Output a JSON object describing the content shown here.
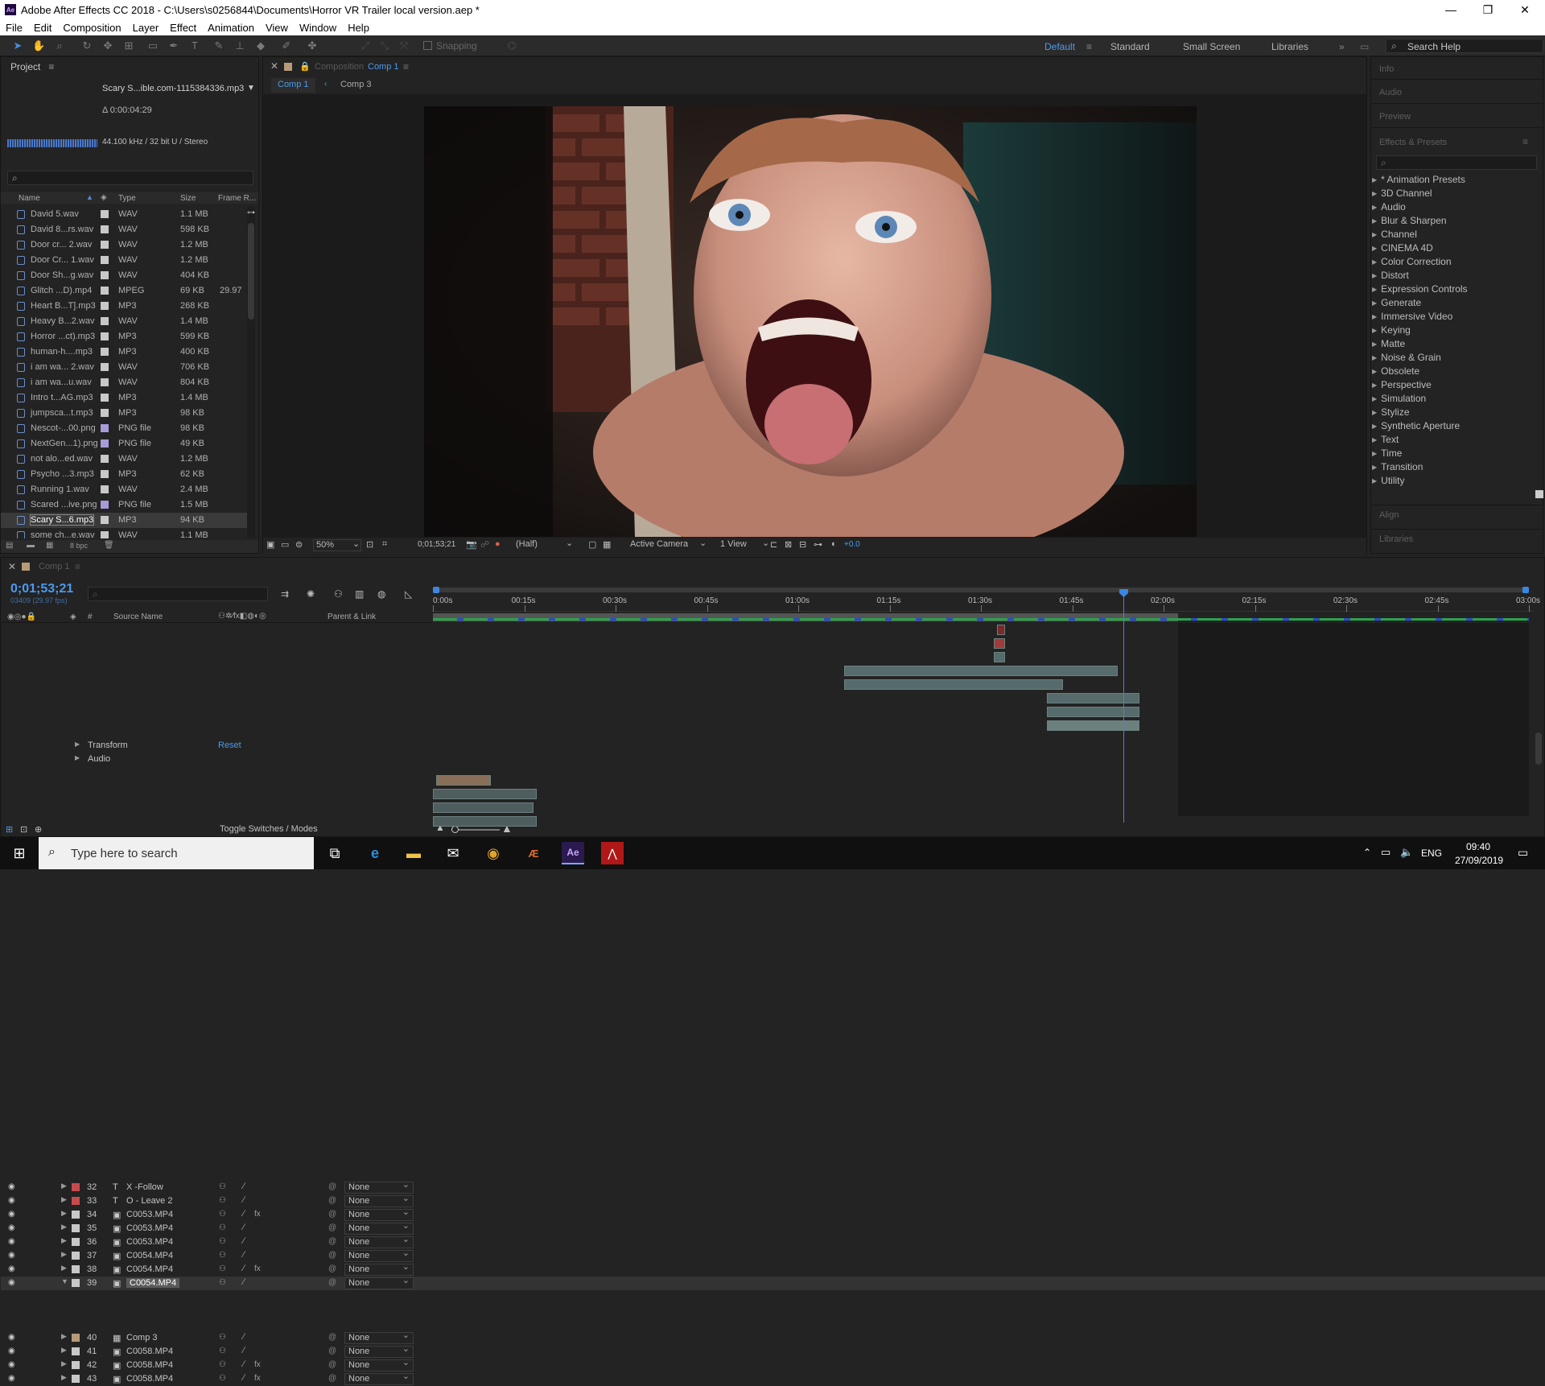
{
  "window": {
    "title": "Adobe After Effects CC 2018 - C:\\Users\\s0256844\\Documents\\Horror VR Trailer local version.aep *",
    "app_badge": "Ae"
  },
  "menu": [
    "File",
    "Edit",
    "Composition",
    "Layer",
    "Effect",
    "Animation",
    "View",
    "Window",
    "Help"
  ],
  "toolbar": {
    "snapping_label": "Snapping",
    "workspaces": [
      "Default",
      "Standard",
      "Small Screen",
      "Libraries"
    ],
    "active_workspace": "Default",
    "search_help": "Search Help"
  },
  "project": {
    "title": "Project",
    "selected_name": "Scary S...ible.com-1115384336.mp3",
    "duration": "Δ 0:00:04:29",
    "audio_info": "44.100 kHz / 32 bit U / Stereo",
    "search_icon": "search-icon",
    "columns": [
      "Name",
      "Type",
      "Size",
      "Frame R..."
    ],
    "items": [
      {
        "name": "David 5.wav",
        "type": "WAV",
        "size": "1.1 MB",
        "rate": "",
        "label_color": "#c8c8c8"
      },
      {
        "name": "David 8...rs.wav",
        "type": "WAV",
        "size": "598 KB",
        "rate": "",
        "label_color": "#c8c8c8"
      },
      {
        "name": "Door cr... 2.wav",
        "type": "WAV",
        "size": "1.2 MB",
        "rate": "",
        "label_color": "#c8c8c8"
      },
      {
        "name": "Door Cr... 1.wav",
        "type": "WAV",
        "size": "1.2 MB",
        "rate": "",
        "label_color": "#c8c8c8"
      },
      {
        "name": "Door Sh...g.wav",
        "type": "WAV",
        "size": "404 KB",
        "rate": "",
        "label_color": "#c8c8c8"
      },
      {
        "name": "Glitch ...D).mp4",
        "type": "MPEG",
        "size": "69 KB",
        "rate": "29.97",
        "label_color": "#c8c8c8"
      },
      {
        "name": "Heart B...T].mp3",
        "type": "MP3",
        "size": "268 KB",
        "rate": "",
        "label_color": "#c8c8c8"
      },
      {
        "name": "Heavy B...2.wav",
        "type": "WAV",
        "size": "1.4 MB",
        "rate": "",
        "label_color": "#c8c8c8"
      },
      {
        "name": "Horror ...ct).mp3",
        "type": "MP3",
        "size": "599 KB",
        "rate": "",
        "label_color": "#c8c8c8"
      },
      {
        "name": "human-h....mp3",
        "type": "MP3",
        "size": "400 KB",
        "rate": "",
        "label_color": "#c8c8c8"
      },
      {
        "name": "i am wa... 2.wav",
        "type": "WAV",
        "size": "706 KB",
        "rate": "",
        "label_color": "#c8c8c8"
      },
      {
        "name": "i am wa...u.wav",
        "type": "WAV",
        "size": "804 KB",
        "rate": "",
        "label_color": "#c8c8c8"
      },
      {
        "name": "Intro t...AG.mp3",
        "type": "MP3",
        "size": "1.4 MB",
        "rate": "",
        "label_color": "#c8c8c8"
      },
      {
        "name": "jumpsca...t.mp3",
        "type": "MP3",
        "size": "98 KB",
        "rate": "",
        "label_color": "#c8c8c8"
      },
      {
        "name": "Nescot-...00.png",
        "type": "PNG file",
        "size": "98 KB",
        "rate": "",
        "label_color": "#a99ad8"
      },
      {
        "name": "NextGen...1).png",
        "type": "PNG file",
        "size": "49 KB",
        "rate": "",
        "label_color": "#a99ad8"
      },
      {
        "name": "not alo...ed.wav",
        "type": "WAV",
        "size": "1.2 MB",
        "rate": "",
        "label_color": "#c8c8c8"
      },
      {
        "name": "Psycho ...3.mp3",
        "type": "MP3",
        "size": "62 KB",
        "rate": "",
        "label_color": "#c8c8c8"
      },
      {
        "name": "Running 1.wav",
        "type": "WAV",
        "size": "2.4 MB",
        "rate": "",
        "label_color": "#c8c8c8"
      },
      {
        "name": "Scared ...ive.png",
        "type": "PNG file",
        "size": "1.5 MB",
        "rate": "",
        "label_color": "#a99ad8"
      },
      {
        "name": "Scary S...6.mp3",
        "type": "MP3",
        "size": "94 KB",
        "rate": "",
        "label_color": "#c8c8c8",
        "selected": true
      },
      {
        "name": "some ch...e.wav",
        "type": "WAV",
        "size": "1.1 MB",
        "rate": "",
        "label_color": "#c8c8c8"
      }
    ],
    "bpc": "8 bpc"
  },
  "composition": {
    "panel_label": "Composition",
    "comp_name": "Comp 1",
    "tabs": [
      "Comp 1",
      "Comp 3"
    ],
    "zoom": "50%",
    "timecode": "0;01;53;21",
    "resolution": "(Half)",
    "camera": "Active Camera",
    "views": "1 View",
    "exposure": "+0.0"
  },
  "effects": {
    "panels_top": [
      "Info",
      "Audio",
      "Preview",
      "Effects & Presets"
    ],
    "categories": [
      "* Animation Presets",
      "3D Channel",
      "Audio",
      "Blur & Sharpen",
      "Channel",
      "CINEMA 4D",
      "Color Correction",
      "Distort",
      "Expression Controls",
      "Generate",
      "Immersive Video",
      "Keying",
      "Matte",
      "Noise & Grain",
      "Obsolete",
      "Perspective",
      "Simulation",
      "Stylize",
      "Synthetic Aperture",
      "Text",
      "Time",
      "Transition",
      "Utility"
    ],
    "panels_bottom": [
      "Align",
      "Libraries"
    ]
  },
  "timeline": {
    "tab": "Comp 1",
    "timecode": "0;01;53;21",
    "frames": "03409 (29.97 fps)",
    "col_source": "Source Name",
    "col_parent": "Parent & Link",
    "ruler": [
      "0:00s",
      "00:15s",
      "00:30s",
      "00:45s",
      "01:00s",
      "01:15s",
      "01:30s",
      "01:45s",
      "02:00s",
      "02:15s",
      "02:30s",
      "02:45s",
      "03:00s"
    ],
    "playhead_fraction": 0.63,
    "work_area_end_fraction": 0.68,
    "layers": [
      {
        "num": "32",
        "icon": "T",
        "name": "X -Follow",
        "label": "#c84b4b",
        "parent": "None",
        "fx": false
      },
      {
        "num": "33",
        "icon": "T",
        "name": "O - Leave 2",
        "label": "#c84b4b",
        "parent": "None",
        "fx": false
      },
      {
        "num": "34",
        "icon": "▣",
        "name": "C0053.MP4",
        "label": "#c8c8c8",
        "parent": "None",
        "fx": true
      },
      {
        "num": "35",
        "icon": "▣",
        "name": "C0053.MP4",
        "label": "#c8c8c8",
        "parent": "None",
        "fx": false
      },
      {
        "num": "36",
        "icon": "▣",
        "name": "C0053.MP4",
        "label": "#c8c8c8",
        "parent": "None",
        "fx": false
      },
      {
        "num": "37",
        "icon": "▣",
        "name": "C0054.MP4",
        "label": "#c8c8c8",
        "parent": "None",
        "fx": false
      },
      {
        "num": "38",
        "icon": "▣",
        "name": "C0054.MP4",
        "label": "#c8c8c8",
        "parent": "None",
        "fx": true
      },
      {
        "num": "39",
        "icon": "▣",
        "name": "C0054.MP4",
        "label": "#c8c8c8",
        "parent": "None",
        "fx": false,
        "selected": true
      },
      {
        "num": "40",
        "icon": "▦",
        "name": "Comp 3",
        "label": "#b99a78",
        "parent": "None",
        "fx": false
      },
      {
        "num": "41",
        "icon": "▣",
        "name": "C0058.MP4",
        "label": "#c8c8c8",
        "parent": "None",
        "fx": false
      },
      {
        "num": "42",
        "icon": "▣",
        "name": "C0058.MP4",
        "label": "#c8c8c8",
        "parent": "None",
        "fx": true
      },
      {
        "num": "43",
        "icon": "▣",
        "name": "C0058.MP4",
        "label": "#c8c8c8",
        "parent": "None",
        "fx": true
      }
    ],
    "sub_transform": "Transform",
    "sub_reset": "Reset",
    "sub_audio": "Audio",
    "toggle_label": "Toggle Switches / Modes"
  },
  "taskbar": {
    "search_placeholder": "Type here to search",
    "lang": "ENG",
    "time": "09:40",
    "date": "27/09/2019"
  }
}
